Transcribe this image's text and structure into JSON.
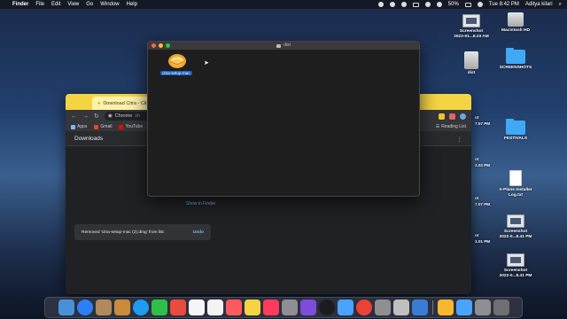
{
  "menubar": {
    "app": "Finder",
    "items": [
      "File",
      "Edit",
      "View",
      "Go",
      "Window",
      "Help"
    ],
    "battery": "50%",
    "clock": "Tue 8:42 PM",
    "user": "Aditya kilari"
  },
  "chrome": {
    "tab_title": "Download Citra - Cit",
    "omnibox_text": "Chrome",
    "omnibox_suffix": "sh",
    "bookmarks": [
      "Apps",
      "Gmail",
      "YouTube"
    ],
    "reading_list": "Reading List",
    "downloads_title": "Downloads",
    "show_in_finder": "Show in Finder",
    "snackbar_text": "Removed 'citra-setup-mac (2).dmg' from list",
    "snackbar_action": "Undo"
  },
  "finder": {
    "title": "dist",
    "file_label": "citra-setup-mac"
  },
  "desktop": {
    "icons": [
      {
        "label1": "Screenshot",
        "label2": "2022-01...8.23 AM"
      },
      {
        "label1": "Macintosh HD",
        "label2": ""
      },
      {
        "label1": "dist",
        "label2": ""
      },
      {
        "label1": "SCREENSHOTS",
        "label2": ""
      },
      {
        "label1": "FESTIVALS",
        "label2": ""
      },
      {
        "label1": "X-Plane Installer",
        "label2": "Log.txt"
      },
      {
        "label1": "Screenshot",
        "label2": "2022-0...8.41 PM"
      },
      {
        "label1": "Screenshot",
        "label2": "2022-0...8.41 PM"
      }
    ],
    "partials": [
      "ot",
      "7.57 PM",
      "ot",
      "3.02 PM",
      "ot",
      "7.07 PM",
      "ot",
      "3.01 PM"
    ]
  },
  "dock": {
    "colors": [
      "#4a90d9",
      "#2d7ff9",
      "#b08a5a",
      "#c98b3a",
      "#1f9bf0",
      "#2fbf4a",
      "#e94b3c",
      "#f5f5f5",
      "#f3f3f3",
      "#ff5a5f",
      "#f5d443",
      "#ff3b5c",
      "#8e8e93",
      "#7d4cdb",
      "#1c1c1e",
      "#4aa3ff",
      "#ea4335",
      "#8f8f8f",
      "#bfbfbf",
      "#3a7bd5",
      "#f5b82e",
      "#4aa3ff",
      "#8e8e93",
      "#6e6e73"
    ]
  }
}
